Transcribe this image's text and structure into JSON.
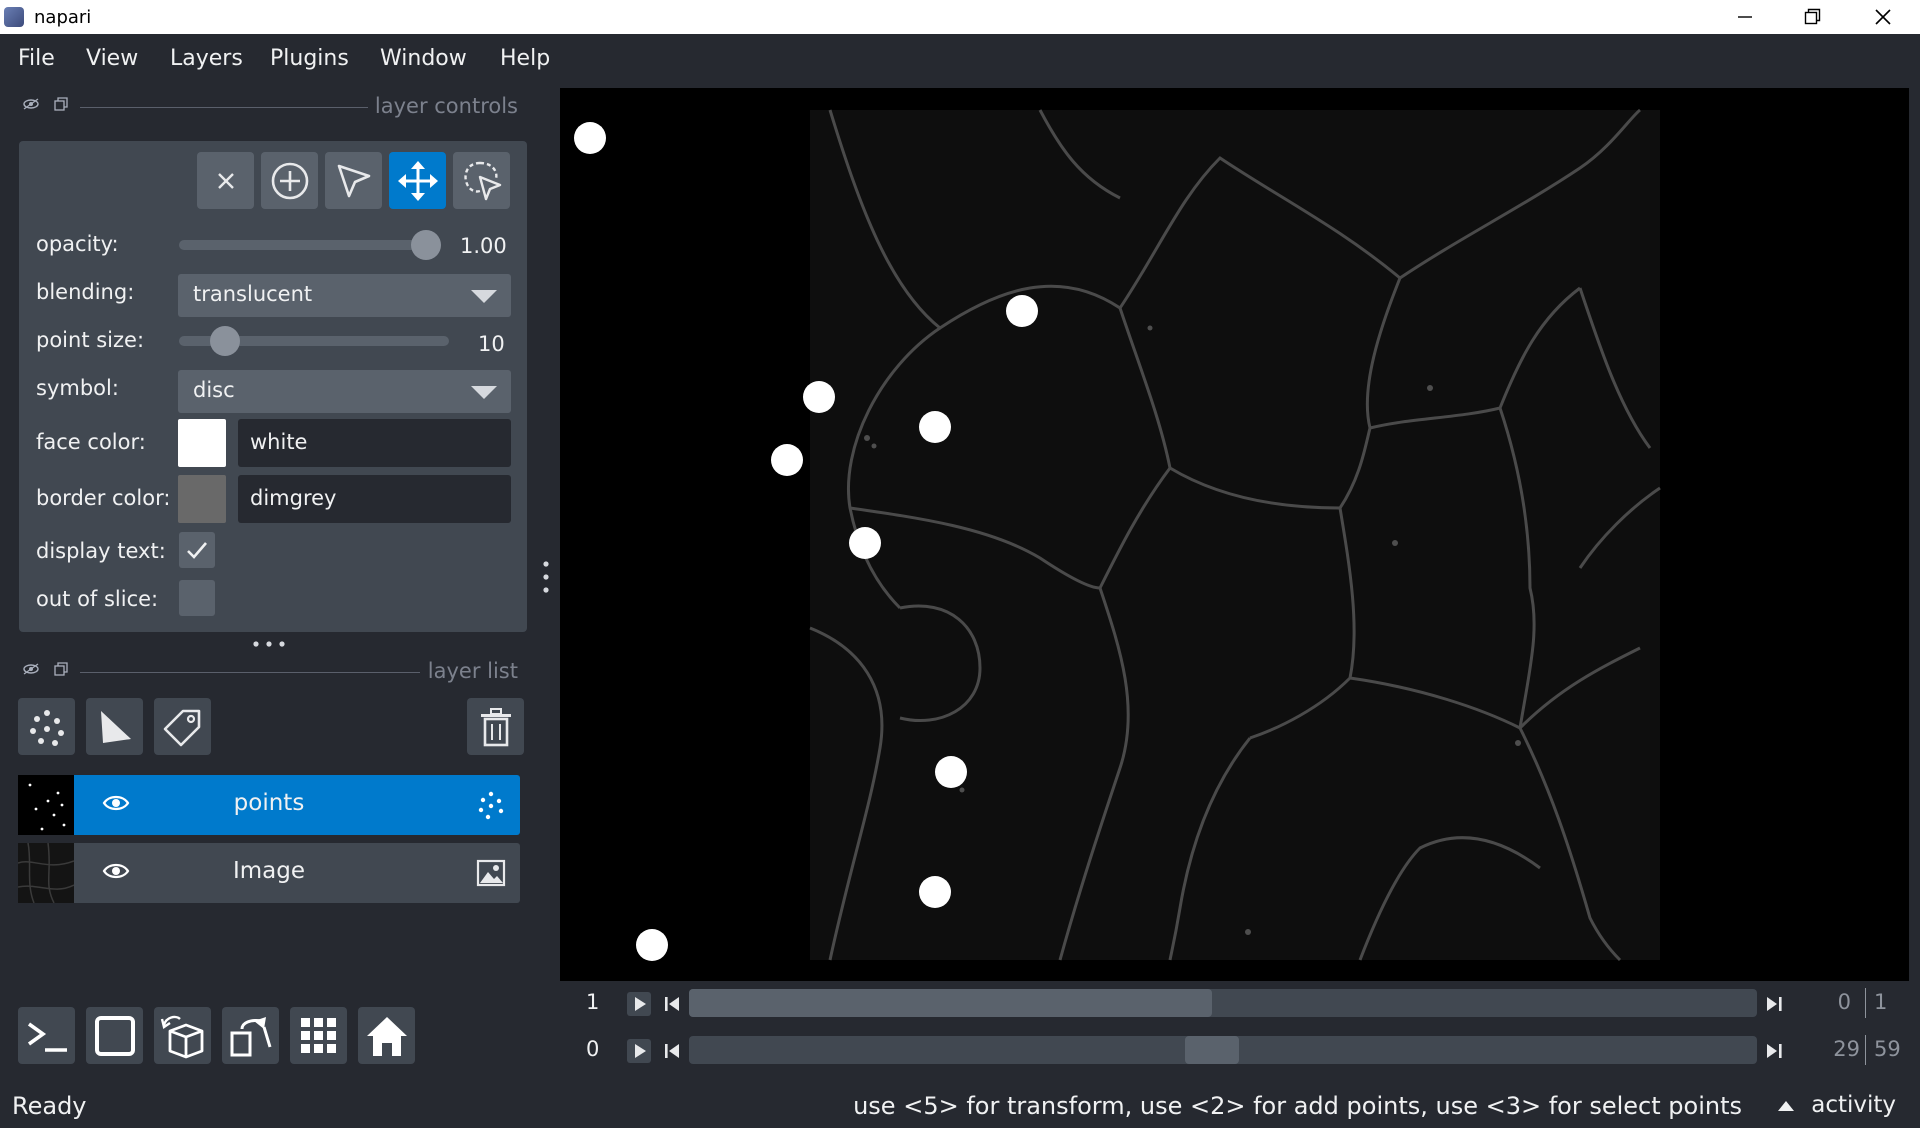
{
  "window": {
    "title": "napari"
  },
  "menu": [
    "File",
    "View",
    "Layers",
    "Plugins",
    "Window",
    "Help"
  ],
  "controls": {
    "header": "layer controls",
    "tools": [
      "delete-selected",
      "add-points",
      "select-points",
      "transform",
      "lasso-select"
    ],
    "active_tool": "transform",
    "opacity_label": "opacity:",
    "opacity_value": "1.00",
    "opacity_level": 1.0,
    "blending_label": "blending:",
    "blending_value": "translucent",
    "point_size_label": "point size:",
    "point_size_value": "10",
    "point_size_level": 0.13,
    "symbol_label": "symbol:",
    "symbol_value": "disc",
    "face_color_label": "face color:",
    "face_color_value": "white",
    "face_color_hex": "#ffffff",
    "border_color_label": "border color:",
    "border_color_value": "dimgrey",
    "border_color_hex": "#696969",
    "display_text_label": "display text:",
    "display_text_checked": true,
    "out_of_slice_label": "out of slice:",
    "out_of_slice_checked": false
  },
  "layer_list": {
    "header": "layer list",
    "layers": [
      {
        "name": "points",
        "type": "points",
        "selected": true,
        "visible": true
      },
      {
        "name": "Image",
        "type": "image",
        "selected": false,
        "visible": true
      }
    ]
  },
  "dims": [
    {
      "axis": "1",
      "current": "0",
      "total": "1",
      "position": 0.49
    },
    {
      "axis": "0",
      "current": "29",
      "total": "59",
      "position": 0.49
    }
  ],
  "status": {
    "ready": "Ready",
    "hint": "use <5> for transform, use <2> for add points, use <3> for select points",
    "activity": "activity"
  },
  "colors": {
    "accent": "#007acc",
    "background": "#262930",
    "panel": "#414851",
    "foreground": "#5a626c"
  }
}
